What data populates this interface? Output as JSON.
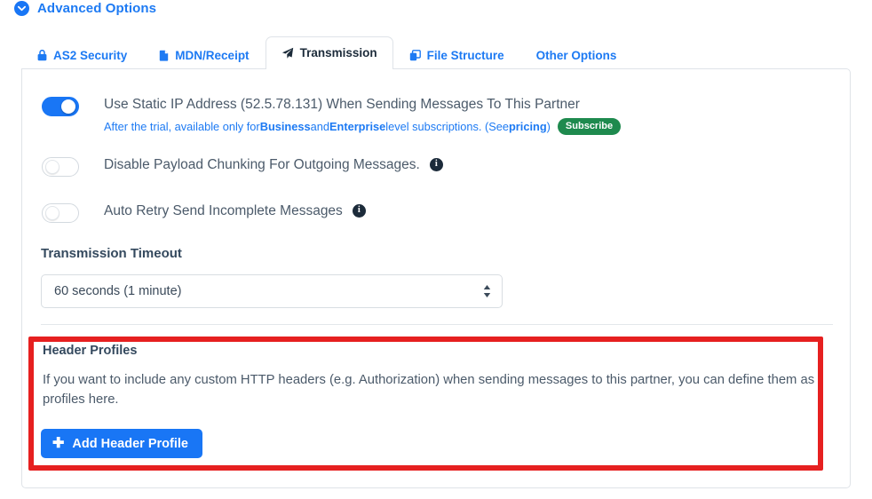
{
  "header": {
    "advanced_options_label": "Advanced Options",
    "caret_icon": "chevron-down-circle-icon"
  },
  "tabs": [
    {
      "id": "as2-security",
      "label": "AS2 Security",
      "icon": "lock-icon",
      "active": false
    },
    {
      "id": "mdn-receipt",
      "label": "MDN/Receipt",
      "icon": "document-icon",
      "active": false
    },
    {
      "id": "transmission",
      "label": "Transmission",
      "icon": "paper-plane-icon",
      "active": true
    },
    {
      "id": "file-structure",
      "label": "File Structure",
      "icon": "copy-files-icon",
      "active": false
    },
    {
      "id": "other-options",
      "label": "Other Options",
      "icon": "",
      "active": false
    }
  ],
  "settings": {
    "static_ip": {
      "label": "Use Static IP Address (52.5.78.131) When Sending Messages To This Partner",
      "state": "on",
      "sub_prefix": "After the trial, available only for ",
      "sub_tier1": "Business",
      "sub_mid": " and ",
      "sub_tier2": "Enterprise",
      "sub_suffix": " level subscriptions. (See ",
      "sub_link": "pricing",
      "sub_close": ")",
      "badge_label": "Subscribe",
      "badge_color": "#1e8a4e"
    },
    "disable_chunking": {
      "label": "Disable Payload Chunking For Outgoing Messages.",
      "state": "off",
      "info_icon": "info-icon"
    },
    "auto_retry": {
      "label": "Auto Retry Send Incomplete Messages",
      "state": "off",
      "info_icon": "info-icon"
    },
    "transmission_timeout": {
      "label": "Transmission Timeout",
      "value": "60 seconds (1 minute)"
    }
  },
  "header_profiles": {
    "title": "Header Profiles",
    "description": "If you want to include any custom HTTP headers (e.g. Authorization) when sending messages to this partner, you can define them as profiles here.",
    "add_button_label": "Add Header Profile",
    "add_button_icon": "plus-icon"
  },
  "annotation": {
    "type": "highlight-rectangle",
    "color": "#e62020"
  },
  "theme": {
    "accent_blue": "#1976f5",
    "link_blue": "#1d7af3",
    "text_dark": "#34495e",
    "text_body": "#4b5a6a",
    "border": "#dfe3e8"
  }
}
